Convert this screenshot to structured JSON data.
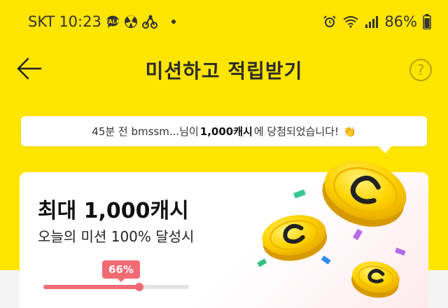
{
  "status_bar": {
    "carrier": "SKT",
    "time": "10:23",
    "battery": "86%",
    "left_icons": [
      "talk-icon",
      "radiation-icon",
      "delivery-icon"
    ],
    "right_icons": [
      "alarm-icon",
      "wifi-icon",
      "signal-icon",
      "battery-icon"
    ]
  },
  "header": {
    "title": "미션하고 적립받기",
    "back_icon": "arrow-left-icon",
    "help_label": "?"
  },
  "winner_banner": {
    "prefix": "45분 전 bmssm...님이",
    "highlight": "1,000캐시",
    "suffix": "에 당첨되었습니다!",
    "emoji": "👏"
  },
  "mission_card": {
    "title": "최대 1,000캐시",
    "subtitle": "오늘의 미션 100% 달성시",
    "progress_label": "66%",
    "progress_value": 0.66
  },
  "colors": {
    "brand_yellow": "#ffe500",
    "accent_pink": "#f26a73",
    "coin_gold": "#f5c800"
  }
}
